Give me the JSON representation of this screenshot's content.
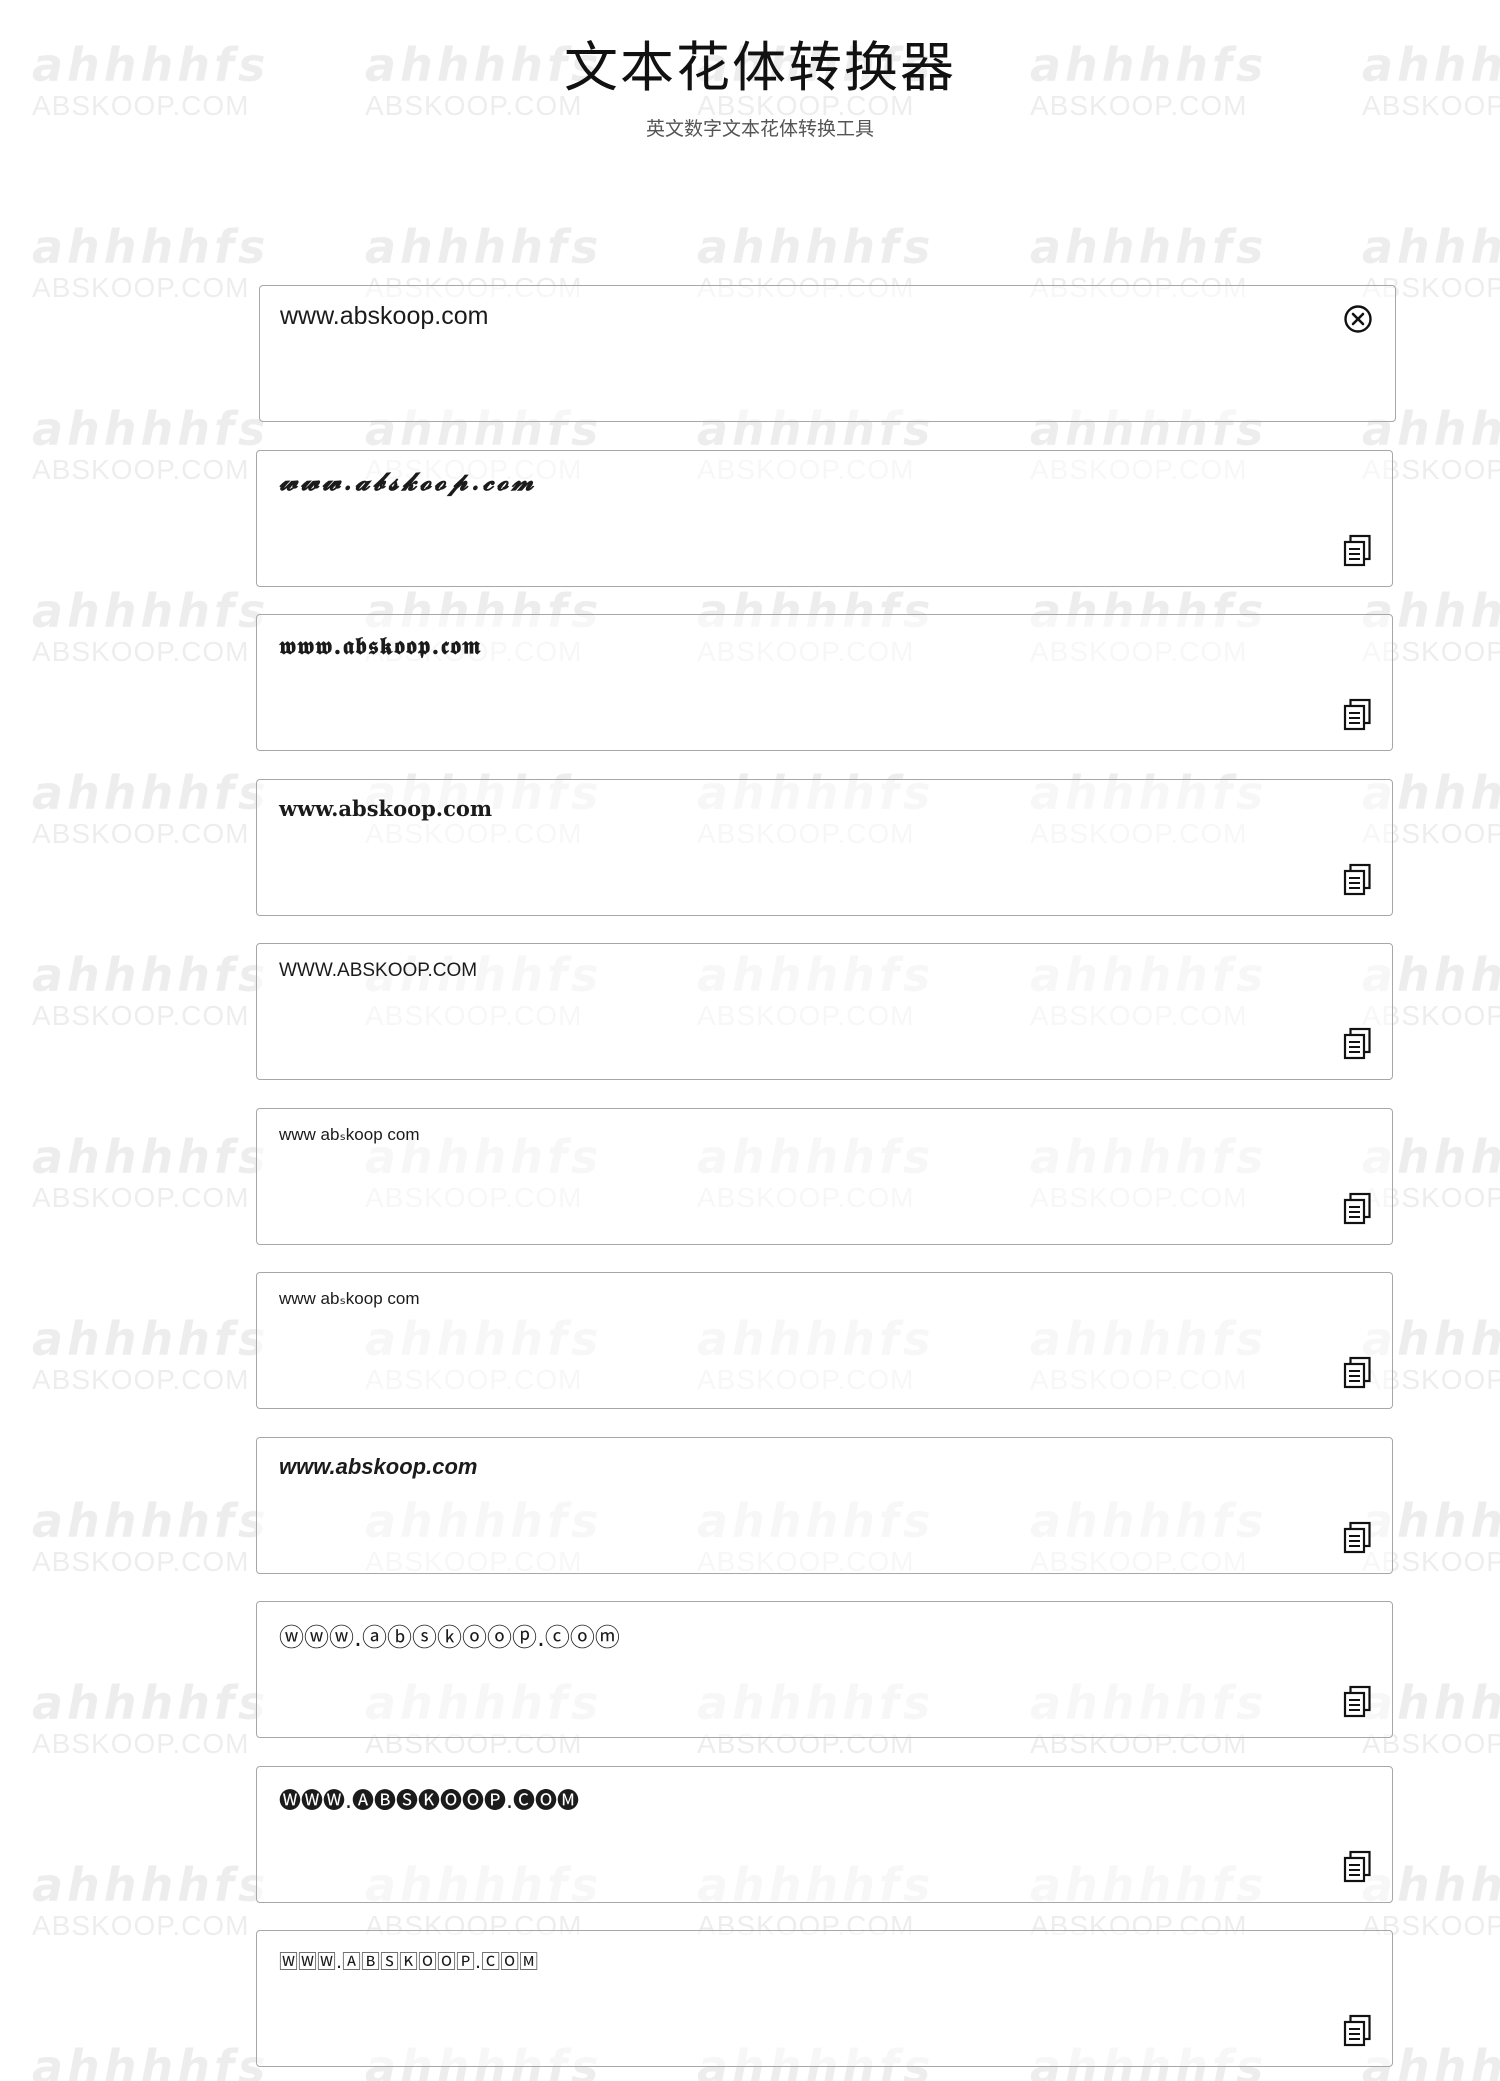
{
  "header": {
    "title": "文本花体转换器",
    "subtitle": "英文数字文本花体转换工具"
  },
  "watermark": {
    "logo": "ahhhhfs",
    "site": "ABSKOOP.COM"
  },
  "input": {
    "value": "www.abskoop.com",
    "clear_icon": "close-circle-icon"
  },
  "outputs": [
    {
      "style": "script",
      "text": "𝔀𝔀𝔀.𝓪𝓫𝓼𝓴𝓸𝓸𝓹.𝓬𝓸𝓶"
    },
    {
      "style": "fraktur",
      "text": "𝖜𝖜𝖜.𝖆𝖇𝖘𝖐𝖔𝖔𝖕.𝖈𝖔𝖒"
    },
    {
      "style": "serif-bold",
      "text": "www.abskoop.com"
    },
    {
      "style": "uppercase",
      "text": "WWW.ABSKOOP.COM"
    },
    {
      "style": "small-sub",
      "text": "www abₛkoop com"
    },
    {
      "style": "small-sub",
      "text": "www abₛkoop com"
    },
    {
      "style": "italic-bold",
      "text": "www.abskoop.com"
    },
    {
      "style": "circled",
      "text": "ⓦⓦⓦ.ⓐⓑⓢⓚⓞⓞⓟ.ⓒⓞⓜ"
    },
    {
      "style": "negative-circled",
      "text": "🅦🅦🅦.🅐🅑🅢🅚🅞🅞🅟.🅒🅞🅜"
    },
    {
      "style": "squared",
      "text": "🅆🅆🅆.🄰🄱🅂🄺🄾🄾🄿.🄲🄾🄼"
    }
  ],
  "copy_icon": "copy-icon"
}
